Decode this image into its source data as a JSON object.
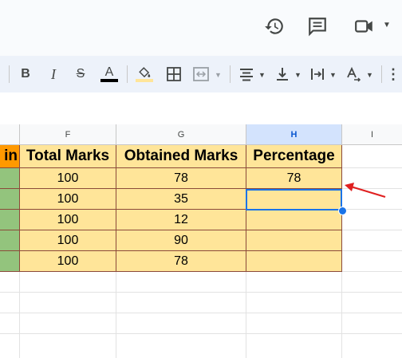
{
  "top_icons": [
    "history-icon",
    "comment-icon",
    "video-call-icon"
  ],
  "toolbar": {
    "bold": "B",
    "italic": "I",
    "strike": "S",
    "text_color": "A",
    "text_color_bar": "#000000",
    "fill_color_bar": "#ffe599"
  },
  "columns": [
    "F",
    "G",
    "H",
    "I"
  ],
  "selected_column": "H",
  "header_row": {
    "partial": "in",
    "total_marks": "Total Marks",
    "obtained_marks": "Obtained Marks",
    "percentage": "Percentage"
  },
  "rows": [
    {
      "total": "100",
      "obtained": "78",
      "percentage": "78"
    },
    {
      "total": "100",
      "obtained": "35",
      "percentage": ""
    },
    {
      "total": "100",
      "obtained": "12",
      "percentage": ""
    },
    {
      "total": "100",
      "obtained": "90",
      "percentage": ""
    },
    {
      "total": "100",
      "obtained": "78",
      "percentage": ""
    }
  ],
  "colors": {
    "header_fill": "#ffe599",
    "left_header_fill": "#ff9900",
    "left_column_fill": "#93c47d",
    "selection": "#1a73e8",
    "arrow": "#e02020"
  }
}
